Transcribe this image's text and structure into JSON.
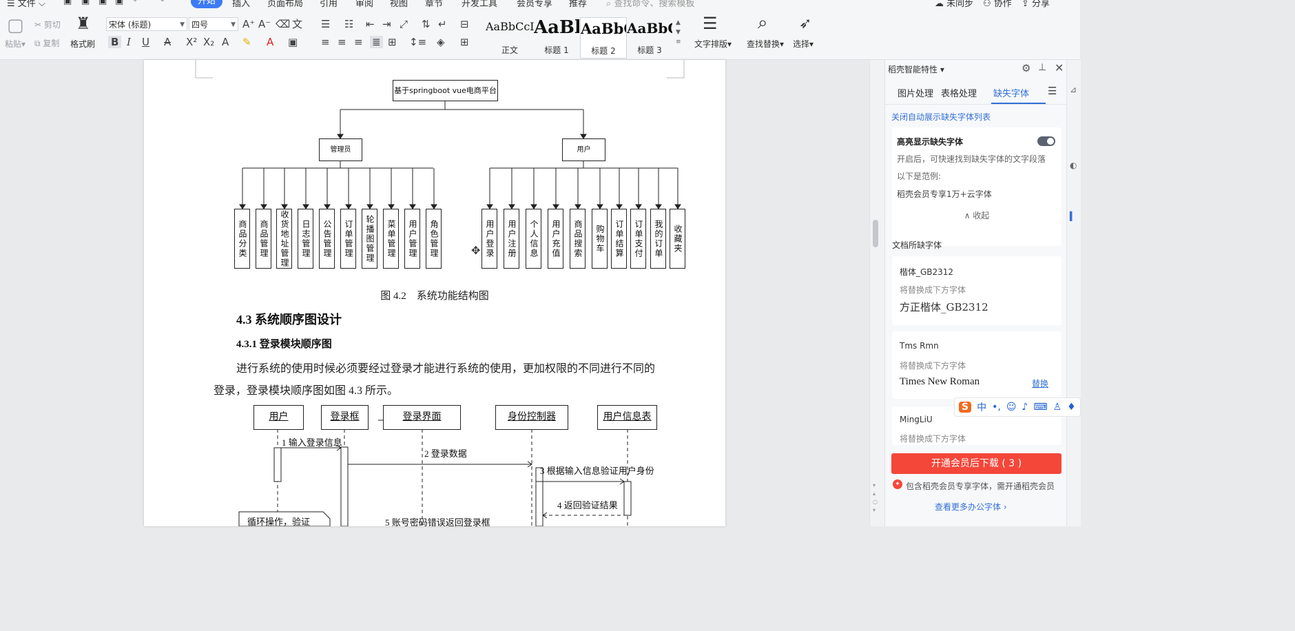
{
  "menu": {
    "file": "文件",
    "tabs": [
      "开始",
      "插入",
      "页面布局",
      "引用",
      "审阅",
      "视图",
      "章节",
      "开发工具",
      "会员专享",
      "推荐"
    ],
    "active_tab": "开始",
    "search_placeholder": "查找命令、搜索模板",
    "sync": "未同步",
    "collab": "协作",
    "share": "分享"
  },
  "ribbon": {
    "paste": "粘贴",
    "cut": "剪切",
    "copy": "复制",
    "format_painter": "格式刷",
    "font_family": "宋体 (标题)",
    "font_size": "四号",
    "styles": [
      {
        "sample": "AaBbCcI",
        "name": "正文"
      },
      {
        "sample": "AaBl",
        "name": "标题 1"
      },
      {
        "sample": "AaBbC",
        "name": "标题 2"
      },
      {
        "sample": "AaBbC",
        "name": "标题 3"
      }
    ],
    "text_layout": "文字排版",
    "find_replace": "查找替换",
    "select": "选择"
  },
  "document": {
    "diagram": {
      "root": "基于springboot vue电商平台",
      "admin": "管理员",
      "user": "用户",
      "admin_modules": [
        "商品分类",
        "商品管理",
        "收货地址管理",
        "日志管理",
        "公告管理",
        "订单管理",
        "轮播图管理",
        "菜单管理",
        "用户管理",
        "角色管理"
      ],
      "user_modules": [
        "用户登录",
        "用户注册",
        "个人信息",
        "用户充值",
        "商品搜索",
        "购物车",
        "订单结算",
        "订单支付",
        "我的订单",
        "收藏夹"
      ]
    },
    "figure_caption": "图 4.2　系统功能结构图",
    "heading": "4.3  系统顺序图设计",
    "subheading": "4.3.1  登录模块顺序图",
    "paragraph_line1": "进行系统的使用时候必须要经过登录才能进行系统的使用，更加权限的不同进行不同的",
    "paragraph_line2": "登录，登录模块顺序图如图 4.3 所示。",
    "sequence": {
      "participants": [
        "用户",
        "登录框",
        "登录界面",
        "身份控制器",
        "用户信息表"
      ],
      "messages": [
        "1  输入登录信息",
        "2  登录数据",
        "3  根据输入信息验证用户身份",
        "4  返回验证结果",
        "5  账号密码错误返回登录框"
      ],
      "note": "循环操作，验证"
    }
  },
  "panel": {
    "title": "稻壳智能特性",
    "tabs": [
      "图片处理",
      "表格处理",
      "缺失字体"
    ],
    "active_tab": "缺失字体",
    "close_auto": "关闭自动展示缺失字体列表",
    "highlight_title": "高亮显示缺失字体",
    "highlight_desc": "开启后，可快速找到缺失字体的文字段落",
    "example_label": "以下是范例:",
    "example_text": "稻壳会员专享1万+云字体",
    "collapse": "收起",
    "doc_missing": "文档所缺字体",
    "replace_hint": "将替换成下方字体",
    "fonts": [
      {
        "missing": "楷体_GB2312",
        "replacement": "方正楷体_GB2312"
      },
      {
        "missing": "Tms Rmn",
        "replacement": "Times New Roman",
        "action": "替换"
      },
      {
        "missing": "MingLiU",
        "replacement": ""
      }
    ],
    "download_button": "开通会员后下载 ( 3 )",
    "notice": "包含稻壳会员专享字体，需开通稻壳会员",
    "more_link": "查看更多办公字体"
  },
  "ime": {
    "label": "中"
  },
  "colors": {
    "accent": "#3d7bf6",
    "download": "#f4473a",
    "link": "#3370d7"
  }
}
